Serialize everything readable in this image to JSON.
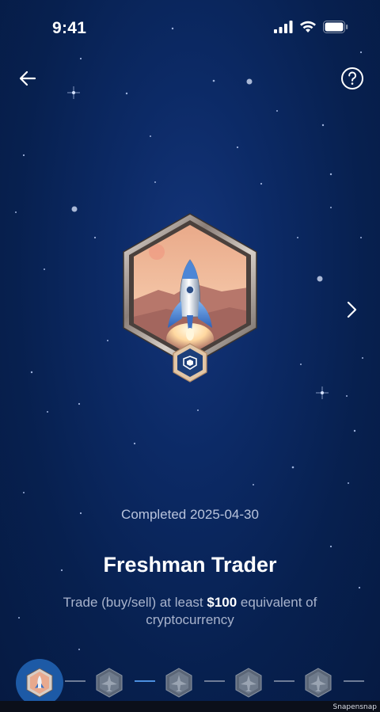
{
  "status_bar": {
    "time": "9:41",
    "icons": [
      "signal-icon",
      "wifi-icon",
      "battery-icon"
    ]
  },
  "nav": {
    "back_icon": "arrow-left-icon",
    "help_icon": "question-circle-icon",
    "next_icon": "chevron-right-icon"
  },
  "badge": {
    "icon": "rocket-badge-icon",
    "emblem_icon": "cryptocom-lion-icon",
    "completed": "Completed 2025-04-30",
    "title": "Freshman Trader",
    "description_prefix": "Trade (buy/sell) at least ",
    "description_amount": "$100",
    "description_suffix": " equivalent of cryptocurrency"
  },
  "progress": {
    "items": [
      {
        "name": "badge-level-1",
        "state": "completed",
        "icon": "rocket-badge-icon"
      },
      {
        "name": "badge-level-2",
        "state": "locked",
        "icon": "jet-badge-icon"
      },
      {
        "name": "badge-level-3",
        "state": "locked",
        "icon": "jet-badge-icon"
      },
      {
        "name": "badge-level-4",
        "state": "locked",
        "icon": "jet-badge-icon"
      },
      {
        "name": "badge-level-5",
        "state": "locked",
        "icon": "jet-badge-icon"
      }
    ]
  },
  "colors": {
    "background": "#0c2a66",
    "active_ring": "#1d5aa6",
    "text_muted": "#a8b3cc"
  },
  "watermark": "Snapensnap"
}
